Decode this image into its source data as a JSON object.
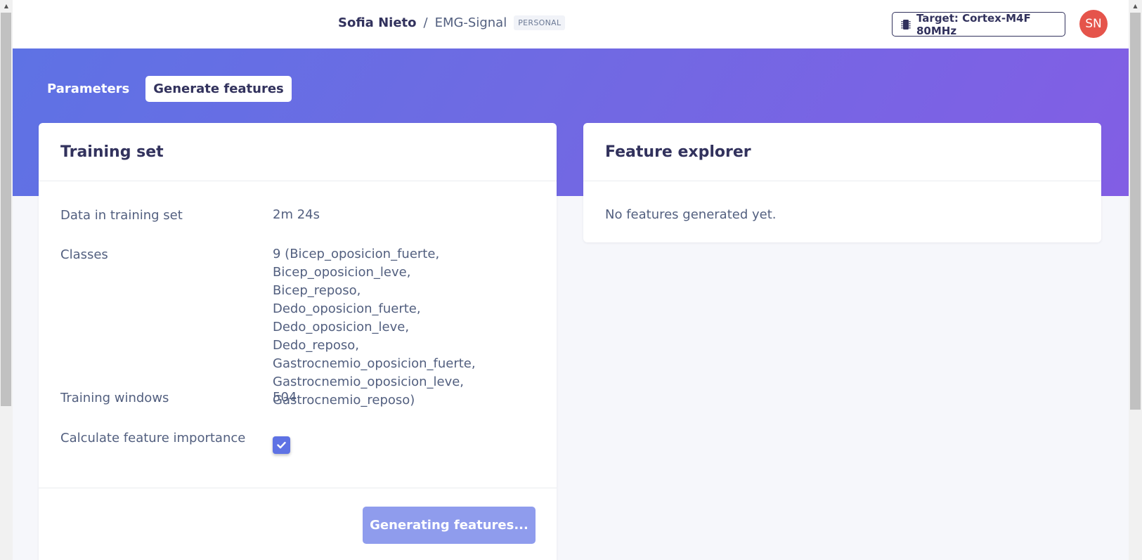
{
  "header": {
    "owner": "Sofia Nieto",
    "separator": "/",
    "project": "EMG-Signal",
    "badge": "PERSONAL",
    "target_label": "Target: Cortex-M4F 80MHz",
    "avatar_initials": "SN"
  },
  "tabs": [
    {
      "label": "Parameters",
      "active": false
    },
    {
      "label": "Generate features",
      "active": true
    }
  ],
  "training_set": {
    "title": "Training set",
    "rows": [
      {
        "label": "Data in training set",
        "value": "2m 24s"
      },
      {
        "label": "Classes",
        "value": "9 (Bicep_oposicion_fuerte, Bicep_oposicion_leve, Bicep_reposo, Dedo_oposicion_fuerte, Dedo_oposicion_leve, Dedo_reposo, Gastrocnemio_oposicion_fuerte, Gastrocnemio_oposicion_leve, Gastrocnemio_reposo)"
      },
      {
        "label": "Training windows",
        "value": "504"
      },
      {
        "label": "Calculate feature importance",
        "checked": true
      }
    ],
    "button_label": "Generating features..."
  },
  "feature_explorer": {
    "title": "Feature explorer",
    "empty_message": "No features generated yet."
  },
  "colors": {
    "accent": "#5e72e4",
    "gradient_end": "#825ee4",
    "avatar": "#e5544b",
    "button_disabled": "#8f9ced"
  }
}
